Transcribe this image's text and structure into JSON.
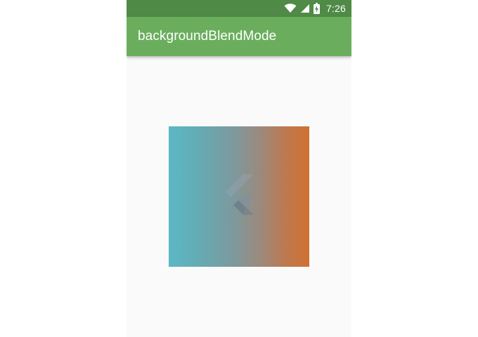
{
  "status_bar": {
    "time": "7:26",
    "icons": [
      "wifi-icon",
      "cell-signal-icon",
      "battery-charging-icon"
    ]
  },
  "app_bar": {
    "title": "backgroundBlendMode"
  },
  "demo": {
    "gradient_colors": [
      "#5bb8c6",
      "#cf7132"
    ],
    "logo": "flutter-logo"
  },
  "colors": {
    "status_bar": "#4f8a47",
    "app_bar": "#6aae5d",
    "background": "#fafafa"
  }
}
